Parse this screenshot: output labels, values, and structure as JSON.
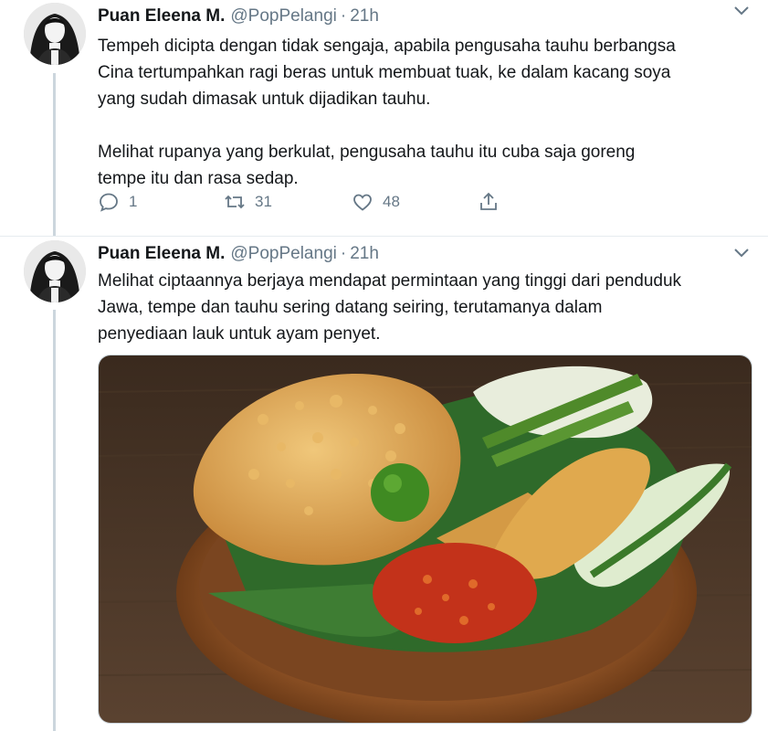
{
  "tweets": [
    {
      "name": "Puan Eleena M.",
      "handle": "@PopPelangi",
      "separator": "·",
      "time": "21h",
      "text": "Tempeh dicipta dengan tidak sengaja, apabila pengusaha tauhu berbangsa\nCina tertumpahkan ragi beras untuk membuat tuak, ke dalam kacang soya\nyang sudah dimasak untuk dijadikan tauhu.\n\nMelihat rupanya yang berkulat, pengusaha tauhu itu cuba saja goreng\ntempe itu dan rasa sedap.",
      "replies": "1",
      "retweets": "31",
      "likes": "48"
    },
    {
      "name": "Puan Eleena M.",
      "handle": "@PopPelangi",
      "separator": "·",
      "time": "21h",
      "text": "Melihat ciptaannya berjaya mendapat permintaan yang tinggi dari penduduk\nJawa, tempe dan tauhu sering datang seiring, terutamanya dalam\npenyediaan lauk untuk ayam penyet.",
      "media_description": "photo"
    }
  ],
  "icons": {
    "reply": "reply-icon",
    "retweet": "retweet-icon",
    "like": "heart-icon",
    "share": "share-icon",
    "more": "chevron-down-icon"
  },
  "colors": {
    "text": "#14171a",
    "secondary": "#657786",
    "thread_line": "#ccd6dd",
    "divider": "#e6ecf0"
  }
}
